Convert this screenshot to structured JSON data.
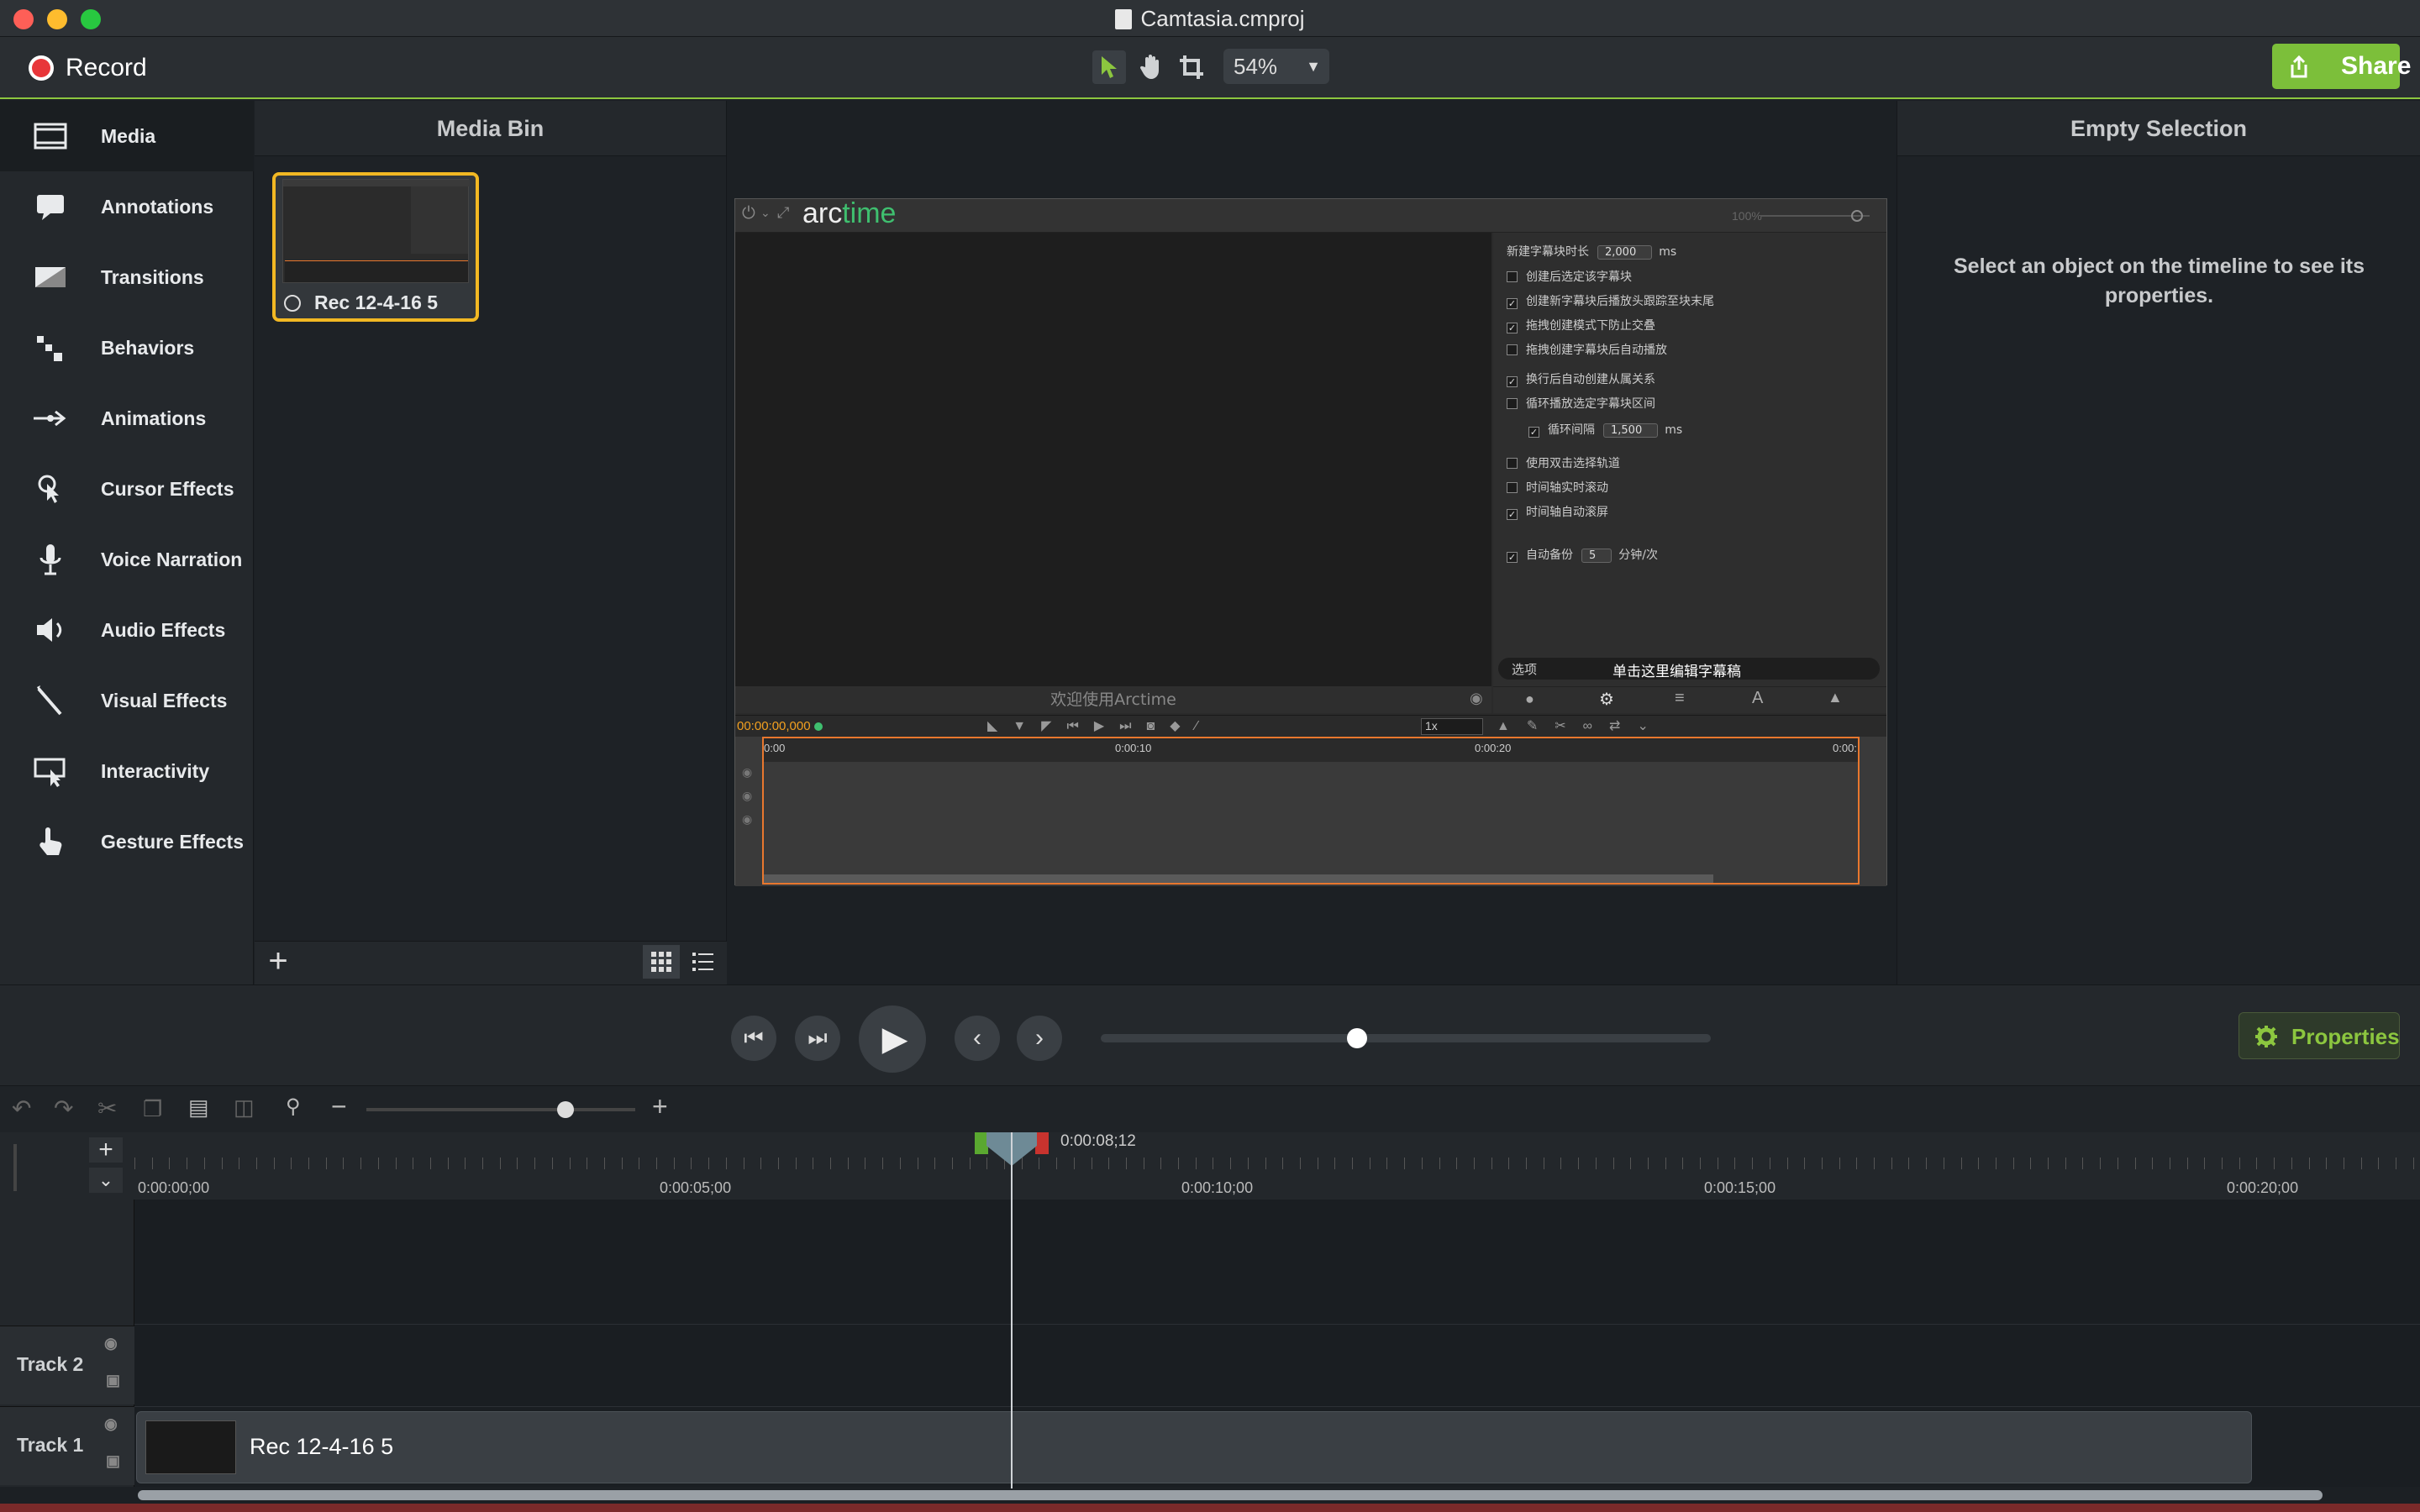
{
  "window": {
    "title": "Camtasia.cmproj"
  },
  "toolbar": {
    "record_label": "Record",
    "zoom": "54%",
    "share_label": "Share"
  },
  "tools": [
    {
      "label": "Media",
      "icon": "film-strip-icon"
    },
    {
      "label": "Annotations",
      "icon": "annotation-icon"
    },
    {
      "label": "Transitions",
      "icon": "transition-icon"
    },
    {
      "label": "Behaviors",
      "icon": "behaviors-icon"
    },
    {
      "label": "Animations",
      "icon": "animation-arrow-icon"
    },
    {
      "label": "Cursor Effects",
      "icon": "cursor-effects-icon"
    },
    {
      "label": "Voice Narration",
      "icon": "microphone-icon"
    },
    {
      "label": "Audio Effects",
      "icon": "speaker-icon"
    },
    {
      "label": "Visual Effects",
      "icon": "magic-wand-icon"
    },
    {
      "label": "Interactivity",
      "icon": "interactivity-icon"
    },
    {
      "label": "Gesture Effects",
      "icon": "hand-gesture-icon"
    }
  ],
  "media_bin": {
    "title": "Media Bin",
    "items": [
      {
        "label": "Rec 12-4-16 5"
      }
    ]
  },
  "properties_panel": {
    "title": "Empty Selection",
    "message": "Select an object on the timeline to see its properties."
  },
  "canvas": {
    "app_logo": {
      "arc": "arc",
      "time": "time"
    },
    "zoom_text": "100%",
    "welcome": "欢迎使用Arctime",
    "timecode": "00:00:00,000",
    "speed": "1x",
    "ruler_labels": [
      "0:00",
      "0:00:10",
      "0:00:20",
      "0:00:"
    ],
    "options_tab": "选项",
    "tooltip": "单击这里编辑字幕稿",
    "settings": [
      {
        "label": "新建字幕块时长",
        "checked": null,
        "value": "2,000",
        "unit": "ms"
      },
      {
        "label": "创建后选定该字幕块",
        "checked": false
      },
      {
        "label": "创建新字幕块后播放头跟踪至块末尾",
        "checked": true
      },
      {
        "label": "拖拽创建模式下防止交叠",
        "checked": true
      },
      {
        "label": "拖拽创建字幕块后自动播放",
        "checked": false
      },
      {
        "label": "换行后自动创建从属关系",
        "checked": true
      },
      {
        "label": "循环播放选定字幕块区间",
        "checked": false
      },
      {
        "label": "循环间隔",
        "checked": true,
        "value": "1,500",
        "unit": "ms"
      },
      {
        "label": "使用双击选择轨道",
        "checked": false
      },
      {
        "label": "时间轴实时滚动",
        "checked": false
      },
      {
        "label": "时间轴自动滚屏",
        "checked": true
      },
      {
        "label": "自动备份",
        "checked": true,
        "value": "5",
        "unit": "分钟/次"
      }
    ]
  },
  "playback": {
    "properties_label": "Properties",
    "progress": 0.42
  },
  "timeline": {
    "playhead_time": "0:00:08;12",
    "ruler_labels": [
      "0:00:00;00",
      "0:00:05;00",
      "0:00:10;00",
      "0:00:15;00",
      "0:00:20;00"
    ],
    "tracks": [
      {
        "label": "Track 2"
      },
      {
        "label": "Track 1"
      }
    ],
    "clip_label": "Rec 12-4-16 5",
    "zoom_level": 0.74
  },
  "colors": {
    "accent": "#8cc63f",
    "record": "#e8363a",
    "selection": "#f2b823",
    "arctime_green": "#3fbf6f"
  }
}
